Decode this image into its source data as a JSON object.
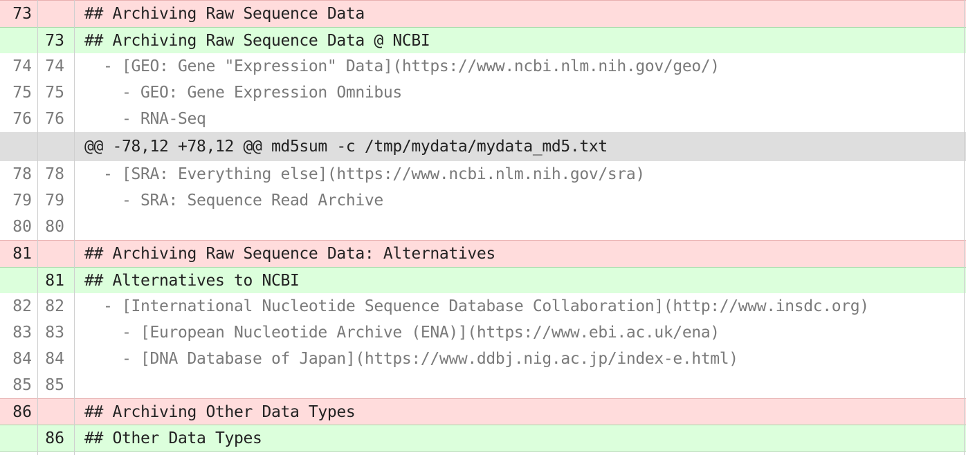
{
  "diff": {
    "lines": [
      {
        "type": "del",
        "old": "73",
        "new": "",
        "text": "## Archiving Raw Sequence Data"
      },
      {
        "type": "add",
        "old": "",
        "new": "73",
        "text": "## Archiving Raw Sequence Data @ NCBI"
      },
      {
        "type": "ctx",
        "old": "74",
        "new": "74",
        "text": "  - [GEO: Gene \"Expression\" Data](https://www.ncbi.nlm.nih.gov/geo/)"
      },
      {
        "type": "ctx",
        "old": "75",
        "new": "75",
        "text": "    - GEO: Gene Expression Omnibus"
      },
      {
        "type": "ctx",
        "old": "76",
        "new": "76",
        "text": "    - RNA-Seq"
      },
      {
        "type": "hunk",
        "old": "",
        "new": "",
        "text": "@@ -78,12 +78,12 @@ md5sum -c /tmp/mydata/mydata_md5.txt"
      },
      {
        "type": "ctx",
        "old": "78",
        "new": "78",
        "text": "  - [SRA: Everything else](https://www.ncbi.nlm.nih.gov/sra)"
      },
      {
        "type": "ctx",
        "old": "79",
        "new": "79",
        "text": "    - SRA: Sequence Read Archive"
      },
      {
        "type": "ctx",
        "old": "80",
        "new": "80",
        "text": ""
      },
      {
        "type": "del",
        "old": "81",
        "new": "",
        "text": "## Archiving Raw Sequence Data: Alternatives"
      },
      {
        "type": "add",
        "old": "",
        "new": "81",
        "text": "## Alternatives to NCBI"
      },
      {
        "type": "ctx",
        "old": "82",
        "new": "82",
        "text": "  - [International Nucleotide Sequence Database Collaboration](http://www.insdc.org)"
      },
      {
        "type": "ctx",
        "old": "83",
        "new": "83",
        "text": "    - [European Nucleotide Archive (ENA)](https://www.ebi.ac.uk/ena)"
      },
      {
        "type": "ctx",
        "old": "84",
        "new": "84",
        "text": "    - [DNA Database of Japan](https://www.ddbj.nig.ac.jp/index-e.html)"
      },
      {
        "type": "ctx",
        "old": "85",
        "new": "85",
        "text": ""
      },
      {
        "type": "del",
        "old": "86",
        "new": "",
        "text": "## Archiving Other Data Types"
      },
      {
        "type": "add",
        "old": "",
        "new": "86",
        "text": "## Other Data Types"
      }
    ]
  }
}
